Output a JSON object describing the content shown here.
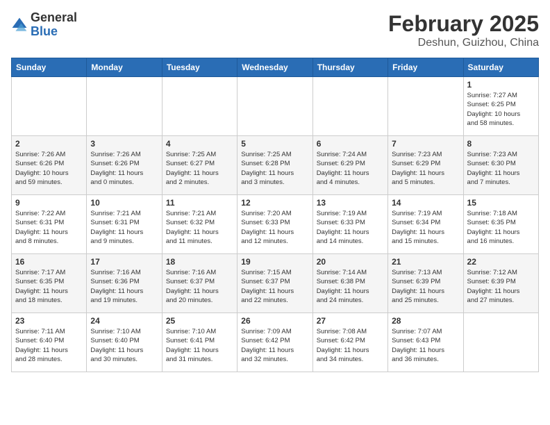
{
  "logo": {
    "general": "General",
    "blue": "Blue"
  },
  "header": {
    "month": "February 2025",
    "location": "Deshun, Guizhou, China"
  },
  "days_of_week": [
    "Sunday",
    "Monday",
    "Tuesday",
    "Wednesday",
    "Thursday",
    "Friday",
    "Saturday"
  ],
  "weeks": [
    [
      {
        "day": "",
        "info": ""
      },
      {
        "day": "",
        "info": ""
      },
      {
        "day": "",
        "info": ""
      },
      {
        "day": "",
        "info": ""
      },
      {
        "day": "",
        "info": ""
      },
      {
        "day": "",
        "info": ""
      },
      {
        "day": "1",
        "info": "Sunrise: 7:27 AM\nSunset: 6:25 PM\nDaylight: 10 hours\nand 58 minutes."
      }
    ],
    [
      {
        "day": "2",
        "info": "Sunrise: 7:26 AM\nSunset: 6:26 PM\nDaylight: 10 hours\nand 59 minutes."
      },
      {
        "day": "3",
        "info": "Sunrise: 7:26 AM\nSunset: 6:26 PM\nDaylight: 11 hours\nand 0 minutes."
      },
      {
        "day": "4",
        "info": "Sunrise: 7:25 AM\nSunset: 6:27 PM\nDaylight: 11 hours\nand 2 minutes."
      },
      {
        "day": "5",
        "info": "Sunrise: 7:25 AM\nSunset: 6:28 PM\nDaylight: 11 hours\nand 3 minutes."
      },
      {
        "day": "6",
        "info": "Sunrise: 7:24 AM\nSunset: 6:29 PM\nDaylight: 11 hours\nand 4 minutes."
      },
      {
        "day": "7",
        "info": "Sunrise: 7:23 AM\nSunset: 6:29 PM\nDaylight: 11 hours\nand 5 minutes."
      },
      {
        "day": "8",
        "info": "Sunrise: 7:23 AM\nSunset: 6:30 PM\nDaylight: 11 hours\nand 7 minutes."
      }
    ],
    [
      {
        "day": "9",
        "info": "Sunrise: 7:22 AM\nSunset: 6:31 PM\nDaylight: 11 hours\nand 8 minutes."
      },
      {
        "day": "10",
        "info": "Sunrise: 7:21 AM\nSunset: 6:31 PM\nDaylight: 11 hours\nand 9 minutes."
      },
      {
        "day": "11",
        "info": "Sunrise: 7:21 AM\nSunset: 6:32 PM\nDaylight: 11 hours\nand 11 minutes."
      },
      {
        "day": "12",
        "info": "Sunrise: 7:20 AM\nSunset: 6:33 PM\nDaylight: 11 hours\nand 12 minutes."
      },
      {
        "day": "13",
        "info": "Sunrise: 7:19 AM\nSunset: 6:33 PM\nDaylight: 11 hours\nand 14 minutes."
      },
      {
        "day": "14",
        "info": "Sunrise: 7:19 AM\nSunset: 6:34 PM\nDaylight: 11 hours\nand 15 minutes."
      },
      {
        "day": "15",
        "info": "Sunrise: 7:18 AM\nSunset: 6:35 PM\nDaylight: 11 hours\nand 16 minutes."
      }
    ],
    [
      {
        "day": "16",
        "info": "Sunrise: 7:17 AM\nSunset: 6:35 PM\nDaylight: 11 hours\nand 18 minutes."
      },
      {
        "day": "17",
        "info": "Sunrise: 7:16 AM\nSunset: 6:36 PM\nDaylight: 11 hours\nand 19 minutes."
      },
      {
        "day": "18",
        "info": "Sunrise: 7:16 AM\nSunset: 6:37 PM\nDaylight: 11 hours\nand 20 minutes."
      },
      {
        "day": "19",
        "info": "Sunrise: 7:15 AM\nSunset: 6:37 PM\nDaylight: 11 hours\nand 22 minutes."
      },
      {
        "day": "20",
        "info": "Sunrise: 7:14 AM\nSunset: 6:38 PM\nDaylight: 11 hours\nand 24 minutes."
      },
      {
        "day": "21",
        "info": "Sunrise: 7:13 AM\nSunset: 6:39 PM\nDaylight: 11 hours\nand 25 minutes."
      },
      {
        "day": "22",
        "info": "Sunrise: 7:12 AM\nSunset: 6:39 PM\nDaylight: 11 hours\nand 27 minutes."
      }
    ],
    [
      {
        "day": "23",
        "info": "Sunrise: 7:11 AM\nSunset: 6:40 PM\nDaylight: 11 hours\nand 28 minutes."
      },
      {
        "day": "24",
        "info": "Sunrise: 7:10 AM\nSunset: 6:40 PM\nDaylight: 11 hours\nand 30 minutes."
      },
      {
        "day": "25",
        "info": "Sunrise: 7:10 AM\nSunset: 6:41 PM\nDaylight: 11 hours\nand 31 minutes."
      },
      {
        "day": "26",
        "info": "Sunrise: 7:09 AM\nSunset: 6:42 PM\nDaylight: 11 hours\nand 32 minutes."
      },
      {
        "day": "27",
        "info": "Sunrise: 7:08 AM\nSunset: 6:42 PM\nDaylight: 11 hours\nand 34 minutes."
      },
      {
        "day": "28",
        "info": "Sunrise: 7:07 AM\nSunset: 6:43 PM\nDaylight: 11 hours\nand 36 minutes."
      },
      {
        "day": "",
        "info": ""
      }
    ]
  ]
}
